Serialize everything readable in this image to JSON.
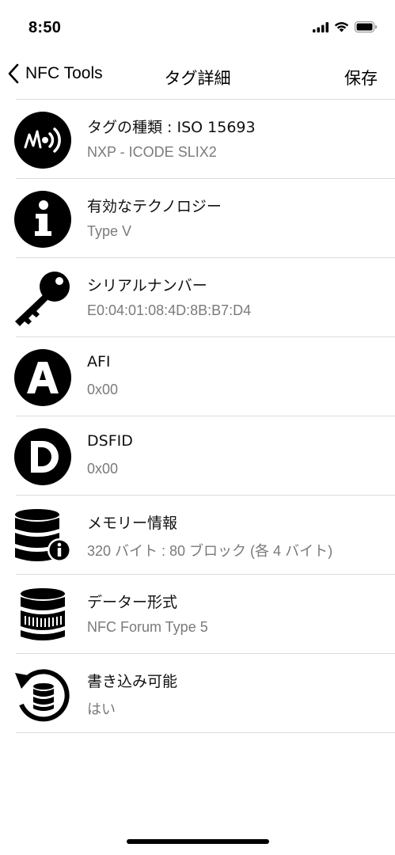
{
  "status_bar": {
    "time": "8:50",
    "icons": [
      "cellular-signal-icon",
      "wifi-icon",
      "battery-icon"
    ]
  },
  "nav": {
    "back_label": "NFC Tools",
    "title": "タグ詳細",
    "save_label": "保存"
  },
  "rows": [
    {
      "icon": "nfc-wave-icon",
      "title": "タグの種類 : ISO 15693",
      "value": "NXP - ICODE SLIX2"
    },
    {
      "icon": "info-icon",
      "title": "有効なテクノロジー",
      "value": "Type V"
    },
    {
      "icon": "key-icon",
      "title": "シリアルナンバー",
      "value": "E0:04:01:08:4D:8B:B7:D4"
    },
    {
      "icon": "letter-a-icon",
      "title": "AFI",
      "value": "0x00"
    },
    {
      "icon": "letter-d-icon",
      "title": "DSFID",
      "value": "0x00"
    },
    {
      "icon": "database-info-icon",
      "title": "メモリー情報",
      "value": "320 バイト : 80 ブロック (各 4 バイト)"
    },
    {
      "icon": "data-format-icon",
      "title": "データー形式",
      "value": "NFC Forum Type 5"
    },
    {
      "icon": "writable-database-icon",
      "title": "書き込み可能",
      "value": "はい"
    }
  ]
}
